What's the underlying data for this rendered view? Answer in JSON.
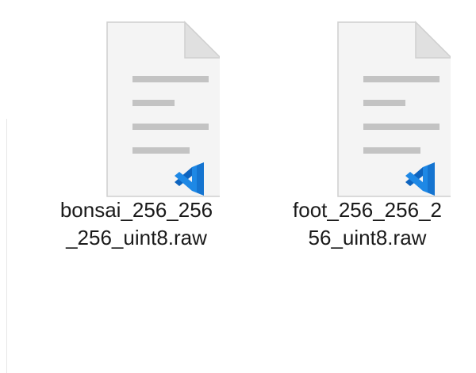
{
  "files": [
    {
      "name_line1": "bonsai_256_256",
      "name_line2": "_256_uint8.raw",
      "icon": "vscode-document-icon"
    },
    {
      "name_line1": "foot_256_256_2",
      "name_line2": "56_uint8.raw",
      "icon": "vscode-document-icon"
    }
  ],
  "colors": {
    "page_fill": "#f3f3f3",
    "page_edge": "#cfcfcf",
    "text_lines": "#c3c3c3",
    "vscode_blue": "#1e88e5",
    "vscode_blue_dark": "#0e64bf"
  }
}
